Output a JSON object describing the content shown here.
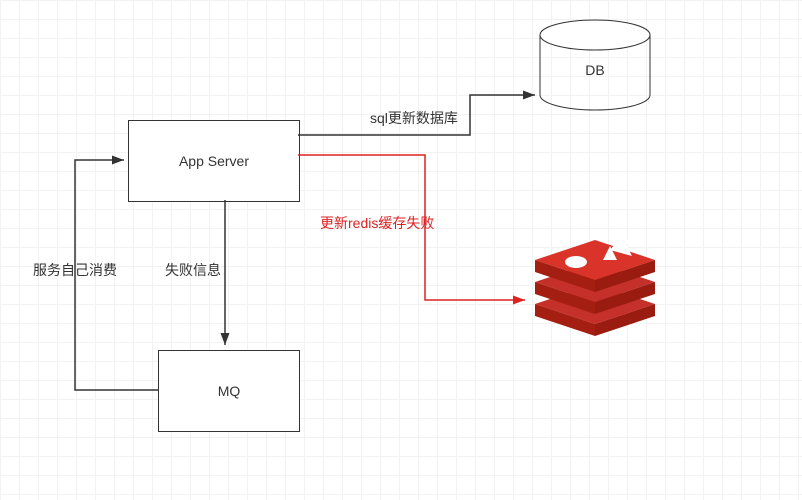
{
  "nodes": {
    "app_server": "App Server",
    "mq": "MQ",
    "db": "DB"
  },
  "edges": {
    "sql_update": "sql更新数据库",
    "redis_fail": "更新redis缓存失败",
    "fail_info": "失败信息",
    "self_consume": "服务自己消费"
  },
  "colors": {
    "line": "#333333",
    "error": "#d22",
    "redis": "#c6302b"
  }
}
